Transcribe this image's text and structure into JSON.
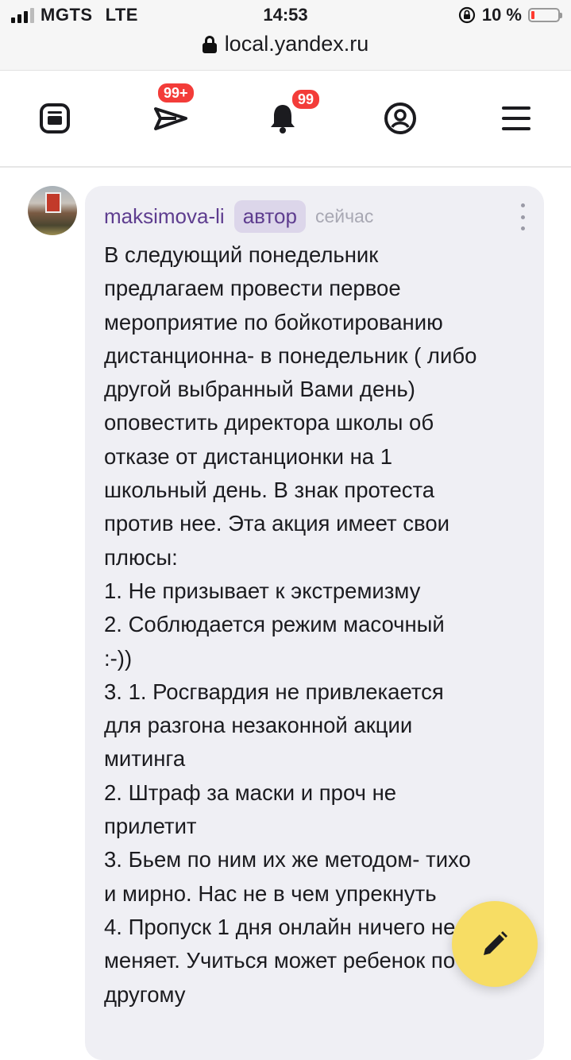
{
  "status": {
    "carrier": "MGTS",
    "network": "LTE",
    "time": "14:53",
    "battery": "10 %",
    "url": "local.yandex.ru"
  },
  "nav": {
    "messages_badge": "99+",
    "notifications_badge": "99"
  },
  "comment": {
    "author": "maksimova-li",
    "role_tag": "автор",
    "time": "сейчас",
    "text": "В следующий понедельник\nпредлагаем провести  первое\nмероприятие по бойкотированию\nдистанционна- в понедельник ( либо\nдругой  выбранный Вами день)\nоповестить  директора школы об\nотказе от дистанционки на 1\nшкольный день.  В знак протеста\nпротив нее.  Эта акция имеет свои\nплюсы:\n1. Не призывает к  экстремизму\n2. Соблюдается режим масочный\n:-))\n3. 1. Росгвардия не привлекается\nдля разгона незаконной акции\nмитинга\n2. Штраф за маски и проч не\nприлетит\n3. Бьем по ним их же методом- тихо\nи мирно. Нас не в чем упрекнуть\n4. Пропуск 1 дня онлайн ничего не\nменяет. Учиться может ребенок по\nдругому"
  },
  "icons": {
    "home": "home-icon",
    "messages": "paper-plane-icon",
    "notifications": "bell-icon",
    "profile": "profile-icon",
    "menu": "hamburger-icon",
    "edit": "pencil-icon"
  },
  "colors": {
    "accent": "#5e3d8f",
    "badge": "#f33c39",
    "fab": "#f7dd64",
    "bubble": "#efeff4"
  }
}
